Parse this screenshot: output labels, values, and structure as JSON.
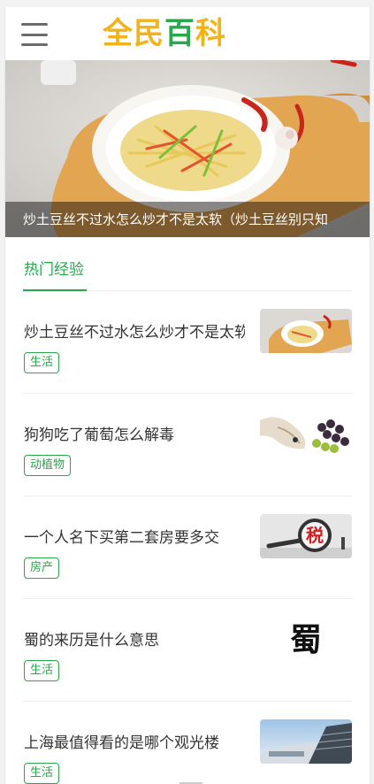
{
  "header": {
    "logo_part1": "全民",
    "logo_part2": "百",
    "logo_part3": "科"
  },
  "banner": {
    "caption": "炒土豆丝不过水怎么炒才不是太软（炒土豆丝别只知"
  },
  "tabs": {
    "hot_label": "热门经验"
  },
  "list": [
    {
      "title": "炒土豆丝不过水怎么炒才不是太软",
      "tag": "生活",
      "thumb": "potato-dish"
    },
    {
      "title": "狗狗吃了葡萄怎么解毒",
      "tag": "动植物",
      "thumb": "dog-grapes"
    },
    {
      "title": "一个人名下买第二套房要多交",
      "tag": "房产",
      "thumb": "tax-magnifier"
    },
    {
      "title": "蜀的来历是什么意思",
      "tag": "生活",
      "thumb": "shu-character"
    },
    {
      "title": "上海最值得看的是哪个观光楼",
      "tag": "生活",
      "thumb": "building-photo"
    }
  ],
  "thumb_texts": {
    "tax": "税",
    "shu": "蜀"
  },
  "colors": {
    "accent": "#26a84b",
    "logo_yellow": "#f2b31a"
  }
}
